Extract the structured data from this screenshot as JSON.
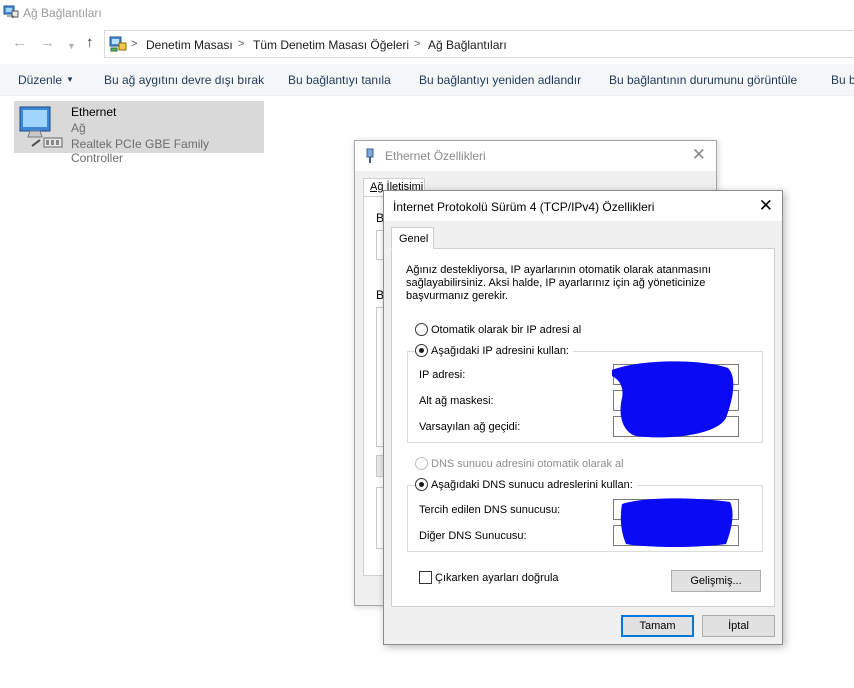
{
  "window": {
    "title": "Ağ Bağlantıları",
    "app_icon": "network-connections-icon"
  },
  "navigation": {
    "back_icon": "back-arrow-icon",
    "forward_icon": "forward-arrow-icon",
    "recent_icon": "chevron-down-icon",
    "up_icon": "up-arrow-icon",
    "breadcrumb": [
      "Denetim Masası",
      "Tüm Denetim Masası Öğeleri",
      "Ağ Bağlantıları"
    ],
    "separator": ">"
  },
  "command_bar": {
    "organize": "Düzenle",
    "items": [
      "Bu ağ aygıtını devre dışı bırak",
      "Bu bağlantıyı tanıla",
      "Bu bağlantıyı yeniden adlandır",
      "Bu bağlantının durumunu görüntüle",
      "Bu b"
    ]
  },
  "connection": {
    "name": "Ethernet",
    "network": "Ağ",
    "adapter": "Realtek PCIe GBE Family Controller",
    "icon": "ethernet-adapter-icon"
  },
  "ethernet_dialog": {
    "title": "Ethernet Özellikleri",
    "tab": "Ağ İletişimi",
    "label_fragment_1": "B",
    "label_fragment_2": "B"
  },
  "ipv4_dialog": {
    "title": "İnternet Protokolü Sürüm 4 (TCP/IPv4) Özellikleri",
    "tab": "Genel",
    "description": "Ağınız destekliyorsa, IP ayarlarının otomatik olarak atanmasını sağlayabilirsiniz. Aksi halde, IP ayarlarınız için ağ yöneticinize başvurmanız gerekir.",
    "ip_auto_label": "Otomatik olarak bir IP adresi al",
    "ip_manual_label": "Aşağıdaki IP adresini kullan:",
    "ip_mode": "manual",
    "ip_fields": [
      {
        "label": "IP adresi:",
        "value": ""
      },
      {
        "label": "Alt ağ maskesi:",
        "value": ""
      },
      {
        "label": "Varsayılan ağ geçidi:",
        "value": ""
      }
    ],
    "dns_auto_label": "DNS sunucu adresini otomatik olarak al",
    "dns_manual_label": "Aşağıdaki DNS sunucu adreslerini kullan:",
    "dns_mode": "manual",
    "dns_fields": [
      {
        "label": "Tercih edilen DNS sunucusu:",
        "value": ""
      },
      {
        "label": "Diğer DNS Sunucusu:",
        "value": ""
      }
    ],
    "validate_label": "Çıkarken ayarları doğrula",
    "validate_checked": false,
    "advanced_button": "Gelişmiş...",
    "ok_button": "Tamam",
    "cancel_button": "İptal",
    "redaction_color": "#0a0af5"
  }
}
